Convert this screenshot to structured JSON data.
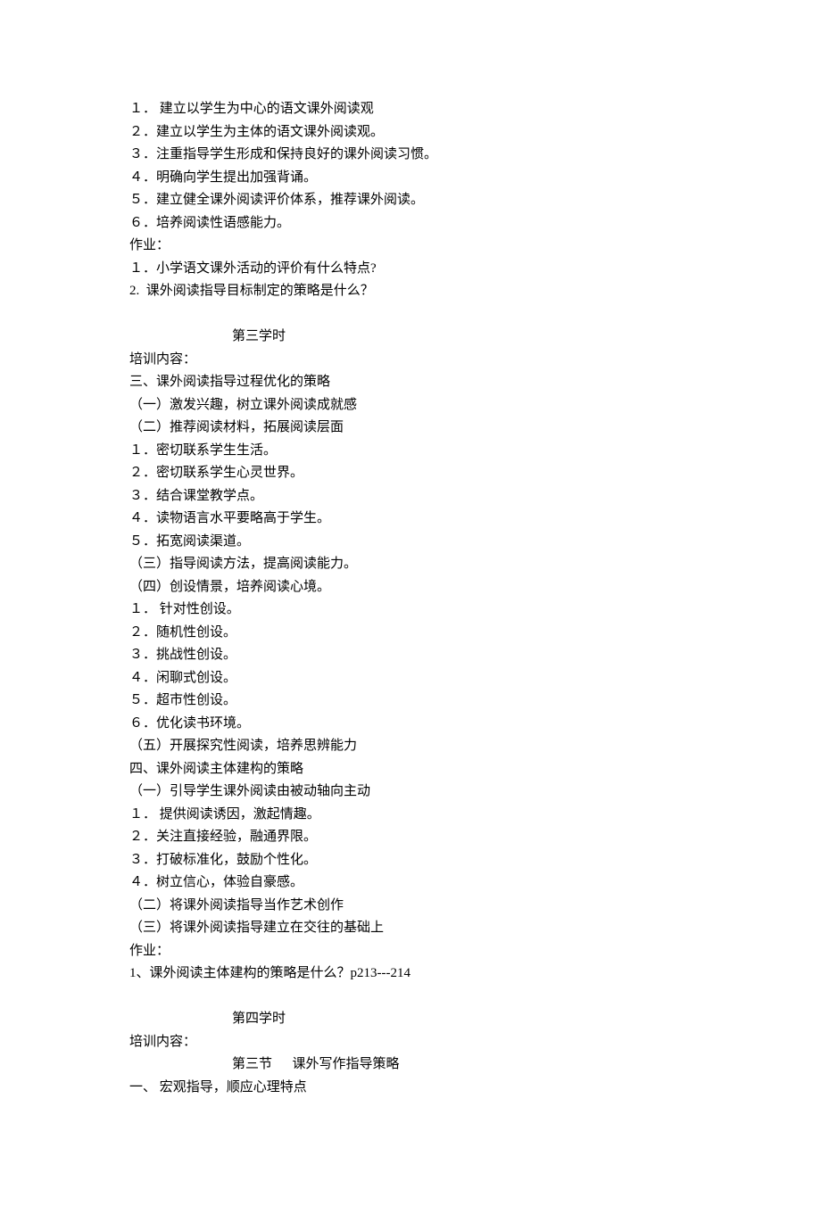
{
  "lines": [
    {
      "kind": "line",
      "text": "１． 建立以学生为中心的语文课外阅读观"
    },
    {
      "kind": "line",
      "text": "２．建立以学生为主体的语文课外阅读观。"
    },
    {
      "kind": "line",
      "text": "３．注重指导学生形成和保持良好的课外阅读习惯。"
    },
    {
      "kind": "line",
      "text": "４．明确向学生提出加强背诵。"
    },
    {
      "kind": "line",
      "text": "５．建立健全课外阅读评价体系，推荐课外阅读。"
    },
    {
      "kind": "line",
      "text": "６．培养阅读性语感能力。"
    },
    {
      "kind": "line",
      "text": "作业："
    },
    {
      "kind": "line",
      "text": "１．小学语文课外活动的评价有什么特点?"
    },
    {
      "kind": "line",
      "text": "2.  课外阅读指导目标制定的策略是什么？"
    },
    {
      "kind": "blank"
    },
    {
      "kind": "section",
      "text": "第三学时"
    },
    {
      "kind": "line",
      "text": "培训内容："
    },
    {
      "kind": "line",
      "text": "三、课外阅读指导过程优化的策略"
    },
    {
      "kind": "line",
      "text": "（一）激发兴趣，树立课外阅读成就感"
    },
    {
      "kind": "line",
      "text": "（二）推荐阅读材料，拓展阅读层面"
    },
    {
      "kind": "line",
      "text": "１．密切联系学生生活。"
    },
    {
      "kind": "line",
      "text": "２．密切联系学生心灵世界。"
    },
    {
      "kind": "line",
      "text": "３．结合课堂教学点。"
    },
    {
      "kind": "line",
      "text": "４．读物语言水平要略高于学生。"
    },
    {
      "kind": "line",
      "text": "５．拓宽阅读渠道。"
    },
    {
      "kind": "line",
      "text": "（三）指导阅读方法，提高阅读能力。"
    },
    {
      "kind": "line",
      "text": "（四）创设情景，培养阅读心境。"
    },
    {
      "kind": "line",
      "text": "１． 针对性创设。"
    },
    {
      "kind": "line",
      "text": "２．随机性创设。"
    },
    {
      "kind": "line",
      "text": "３．挑战性创设。"
    },
    {
      "kind": "line",
      "text": "４．闲聊式创设。"
    },
    {
      "kind": "line",
      "text": "５．超市性创设。"
    },
    {
      "kind": "line",
      "text": "６．优化读书环境。"
    },
    {
      "kind": "line",
      "text": "（五）开展探究性阅读，培养思辨能力"
    },
    {
      "kind": "line",
      "text": "四、课外阅读主体建构的策略"
    },
    {
      "kind": "line",
      "text": "（一）引导学生课外阅读由被动轴向主动"
    },
    {
      "kind": "line",
      "text": "１． 提供阅读诱因，激起情趣。"
    },
    {
      "kind": "line",
      "text": "２．关注直接经验，融通界限。"
    },
    {
      "kind": "line",
      "text": "３．打破标准化，鼓励个性化。"
    },
    {
      "kind": "line",
      "text": "４．树立信心，体验自豪感。"
    },
    {
      "kind": "line",
      "text": "（二）将课外阅读指导当作艺术创作"
    },
    {
      "kind": "line",
      "text": "（三）将课外阅读指导建立在交往的基础上"
    },
    {
      "kind": "line",
      "text": "作业："
    },
    {
      "kind": "line",
      "text": "1、课外阅读主体建构的策略是什么？p213---214"
    },
    {
      "kind": "blank"
    },
    {
      "kind": "section",
      "text": "第四学时"
    },
    {
      "kind": "line",
      "text": "培训内容："
    },
    {
      "kind": "subsection",
      "text": "第三节      课外写作指导策略"
    },
    {
      "kind": "line",
      "text": "一、 宏观指导，顺应心理特点"
    }
  ]
}
